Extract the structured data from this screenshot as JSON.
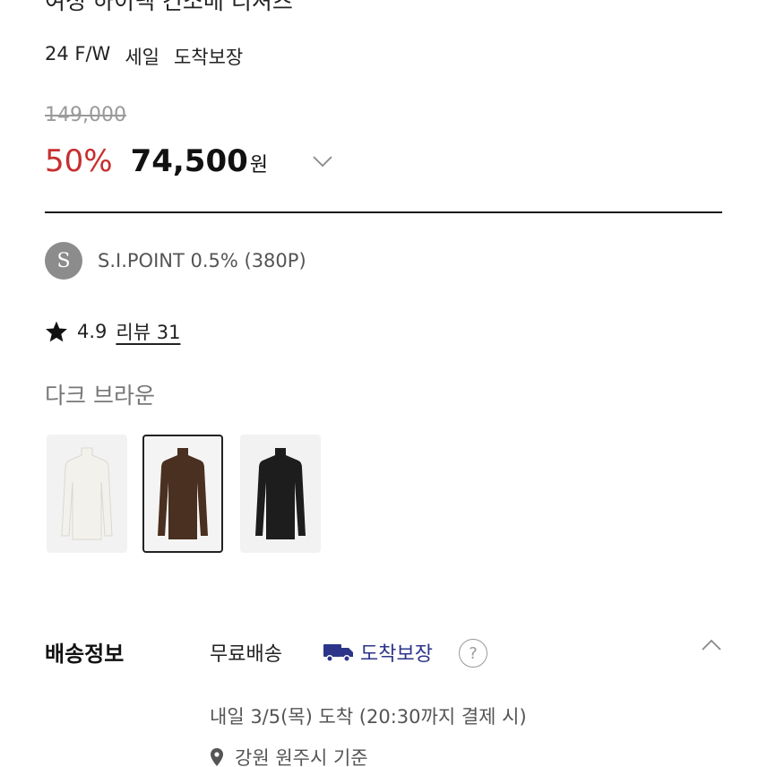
{
  "product": {
    "title_partial": "여성 하이넥 긴소매 티셔츠",
    "tags": [
      "24 F/W",
      "세일",
      "도착보장"
    ],
    "original_price": "149,000",
    "discount": "50%",
    "price": "74,500",
    "currency": "원"
  },
  "points": {
    "badge_letter": "S",
    "text": "S.I.POINT 0.5% (380P)"
  },
  "rating": {
    "value": "4.9",
    "review_label": "리뷰 31"
  },
  "color": {
    "selected_name": "다크 브라운",
    "swatches": [
      {
        "name": "white",
        "color": "#f3f1ec"
      },
      {
        "name": "dark-brown",
        "color": "#4a3020"
      },
      {
        "name": "black",
        "color": "#1d1d1d"
      }
    ]
  },
  "shipping": {
    "label": "배송정보",
    "free": "무료배송",
    "guarantee": "도착보장",
    "help": "?",
    "arrival": "내일 3/5(목) 도착 (20:30까지 결제 시)",
    "location": "강원 원주시 기준"
  },
  "colors": {
    "discount": "#c62f2f",
    "guarantee": "#2c3589"
  }
}
